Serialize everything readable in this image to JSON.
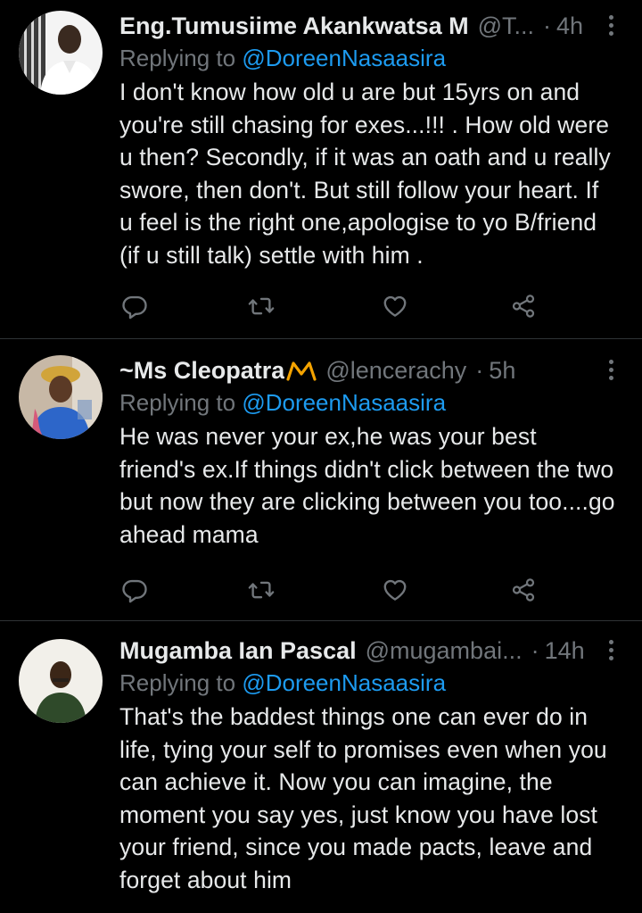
{
  "colors": {
    "background": "#000000",
    "text": "#e7e9ea",
    "muted": "#71767b",
    "accent": "#1d9bf0",
    "divider": "#2f3336"
  },
  "tweets": [
    {
      "name": "Eng.Tumusiime Akankwatsa M",
      "handle": "@T...",
      "dot": "·",
      "time": "4h",
      "reply_prefix": "Replying to ",
      "reply_mention": "@DoreenNasaasira",
      "text": "I don't know how old u are but 15yrs on and you're still chasing for exes...!!! . How old were u then? Secondly, if it was an oath and u really swore, then don't. But still follow your heart. If u feel is the right one,apologise to yo B/friend (if u still talk) settle with him .",
      "avatar_icon": "user-avatar"
    },
    {
      "name": "~Ms Cleopatra",
      "badge_icon": "crown-icon",
      "handle": "@lencerachy",
      "dot": "·",
      "time": "5h",
      "reply_prefix": "Replying to ",
      "reply_mention": "@DoreenNasaasira",
      "text": "He was never your ex,he was your best friend's ex.If things didn't click between the two but now they are clicking between you too....go ahead mama",
      "avatar_icon": "user-avatar"
    },
    {
      "name": "Mugamba Ian Pascal",
      "handle": "@mugambai...",
      "dot": "·",
      "time": "14h",
      "reply_prefix": "Replying to ",
      "reply_mention": "@DoreenNasaasira",
      "text": "That's the baddest things one can ever do in life, tying your self to promises even when you can achieve it. Now you can imagine, the moment you say yes, just know you have lost your friend, since you made pacts, leave and forget about him",
      "avatar_icon": "user-avatar"
    }
  ],
  "action_icons": [
    "reply-icon",
    "retweet-icon",
    "like-icon",
    "share-icon"
  ]
}
